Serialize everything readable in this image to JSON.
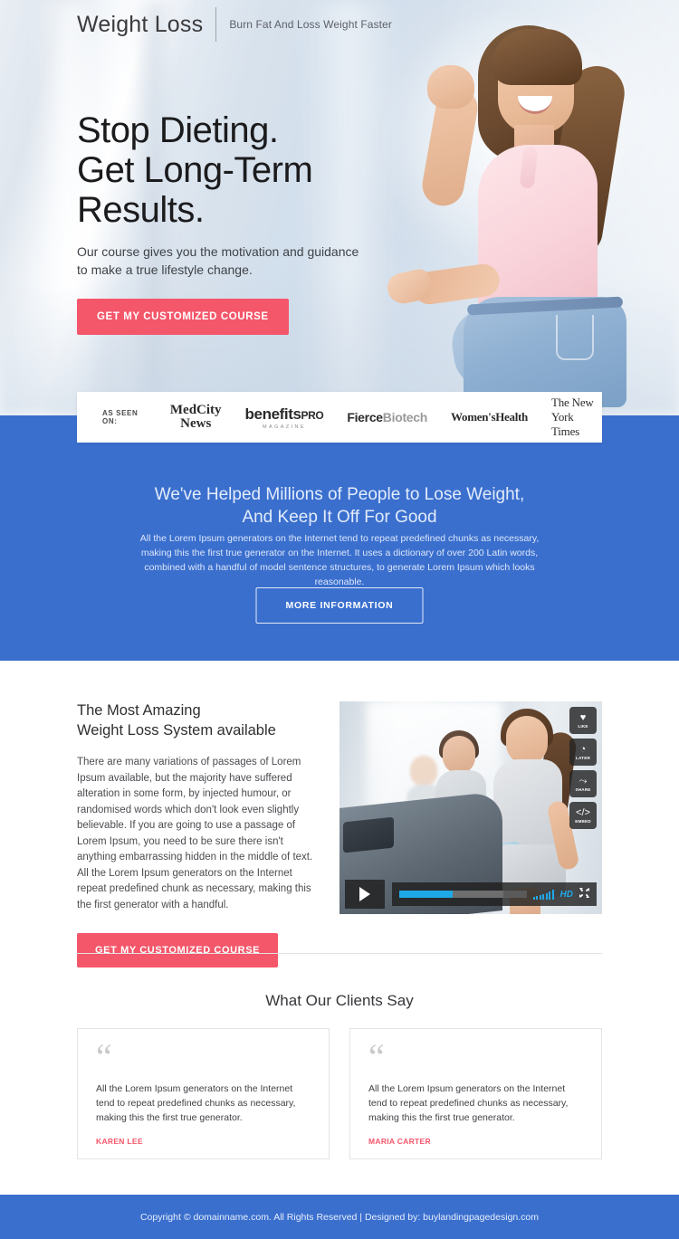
{
  "header": {
    "brand": "Weight Loss",
    "tagline": "Burn Fat And Loss Weight Faster"
  },
  "hero": {
    "title_line1": "Stop Dieting.",
    "title_line2": "Get Long-Term",
    "title_line3": "Results.",
    "subtitle_line1": "Our course gives you the motivation and guidance",
    "subtitle_line2": "to make a true lifestyle change.",
    "cta_label": "GET MY CUSTOMIZED COURSE"
  },
  "press": {
    "label": "AS SEEN ON:",
    "logos": [
      {
        "name": "MedCity News",
        "line1": "MedCity",
        "line2": "News"
      },
      {
        "name": "benefits PRO Magazine",
        "main": "benefits",
        "pro": "PRO",
        "sub": "MAGAZINE"
      },
      {
        "name": "FierceBiotech",
        "part1": "Fierce",
        "part2": "Biotech"
      },
      {
        "name": "Women's Health",
        "text": "Women'sHealth"
      },
      {
        "name": "The New York Times",
        "text": "The New York Times"
      }
    ]
  },
  "blue_section": {
    "heading_line1": "We've Helped Millions of People to Lose Weight,",
    "heading_line2": "And Keep It Off For Good",
    "body": "All the Lorem Ipsum generators on the Internet tend to repeat predefined chunks as necessary, making this the first true generator on the Internet. It uses a dictionary of over 200 Latin words, combined with a handful of model sentence structures, to generate Lorem Ipsum which looks reasonable.",
    "button_label": "MORE INFORMATION",
    "background_color": "#3a6fce"
  },
  "feature": {
    "title_line1": "The Most Amazing",
    "title_line2": "Weight Loss System available",
    "body": "There are many variations of passages of Lorem Ipsum available, but the majority have suffered alteration in some form, by injected humour, or randomised words which don't look even slightly believable. If you are going to use a passage of Lorem Ipsum, you need to be sure there isn't anything embarrassing hidden in the middle of text. All the Lorem Ipsum generators on the Internet repeat predefined chunk as necessary, making this the first generator with a handful.",
    "cta_label": "GET MY CUSTOMIZED COURSE"
  },
  "video": {
    "side_buttons": [
      {
        "icon": "heart-icon",
        "glyph": "♥",
        "label": "LIKE"
      },
      {
        "icon": "clock-icon",
        "glyph": "◔",
        "label": "LATER"
      },
      {
        "icon": "share-icon",
        "glyph": "⤳",
        "label": "SHARE"
      },
      {
        "icon": "embed-icon",
        "glyph": "</>",
        "label": "EMBED"
      }
    ],
    "play_label": "play",
    "progress_percent": 42,
    "buffered_percent": 82,
    "quality_label": "HD",
    "fullscreen_label": "fullscreen"
  },
  "testimonials": {
    "title": "What Our Clients Say",
    "items": [
      {
        "quote": "All the Lorem Ipsum generators on the Internet tend to repeat predefined chunks as necessary, making this the first true generator.",
        "author": "KAREN LEE"
      },
      {
        "quote": "All the Lorem Ipsum generators on the Internet tend to repeat predefined chunks as necessary, making this the first true generator.",
        "author": "MARIA CARTER"
      }
    ]
  },
  "footer": {
    "text": "Copyright © domainname.com. All Rights Reserved  |  Designed by: buylandingpagedesign.com"
  },
  "colors": {
    "accent_red": "#f4566a",
    "brand_blue": "#3a6fce",
    "video_blue": "#1fa8e8"
  }
}
